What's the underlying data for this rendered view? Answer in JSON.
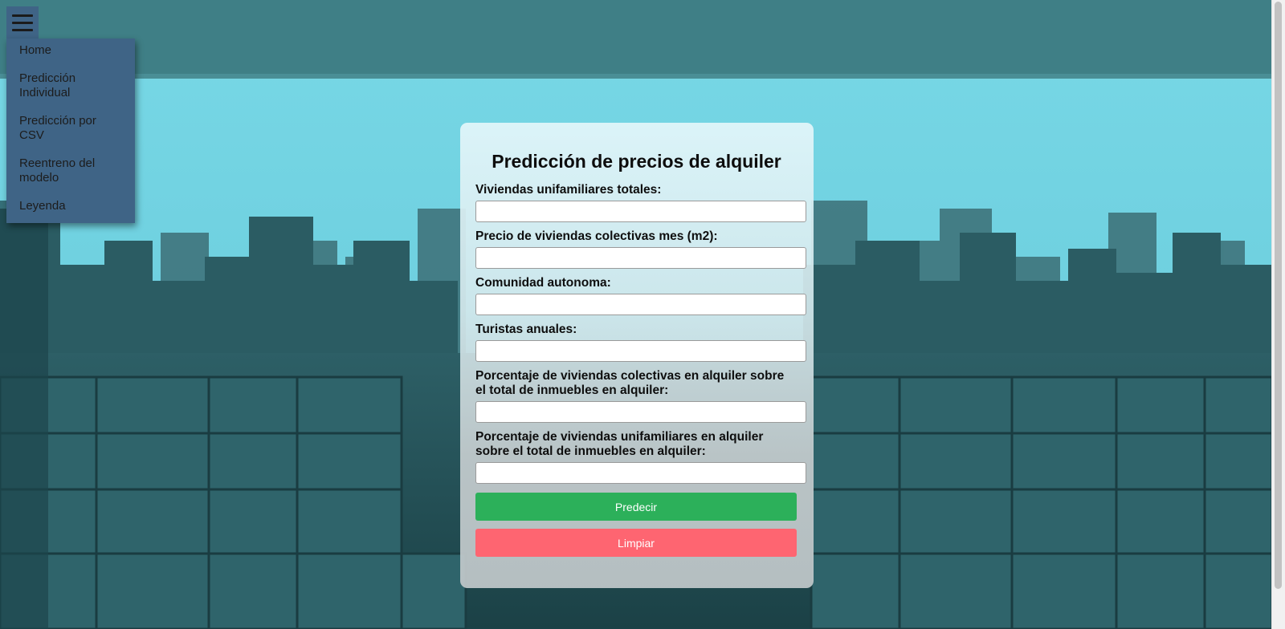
{
  "menu": {
    "items": [
      {
        "label": "Home"
      },
      {
        "label": "Predicción Individual"
      },
      {
        "label": "Predicción por CSV"
      },
      {
        "label": "Reentreno del modelo"
      },
      {
        "label": "Leyenda"
      }
    ]
  },
  "form": {
    "title": "Predicción de precios de alquiler",
    "fields": [
      {
        "label": "Viviendas unifamiliares totales:",
        "value": ""
      },
      {
        "label": "Precio de viviendas colectivas mes (m2):",
        "value": ""
      },
      {
        "label": "Comunidad autonoma:",
        "value": ""
      },
      {
        "label": "Turistas anuales:",
        "value": ""
      },
      {
        "label": "Porcentaje de viviendas colectivas en alquiler sobre el total de inmuebles en alquiler:",
        "value": ""
      },
      {
        "label": "Porcentaje de viviendas unifamiliares en alquiler sobre el total de inmuebles en alquiler:",
        "value": ""
      }
    ],
    "predict_label": "Predecir",
    "clear_label": "Limpiar"
  },
  "colors": {
    "menu_bg": "#3f6486",
    "predict_button": "#2cb05a",
    "clear_button": "#fe6571",
    "sky": "#6ccfdf",
    "buildings": "#1f4a50"
  },
  "icons": {
    "menu_toggle": "hamburger-icon"
  }
}
